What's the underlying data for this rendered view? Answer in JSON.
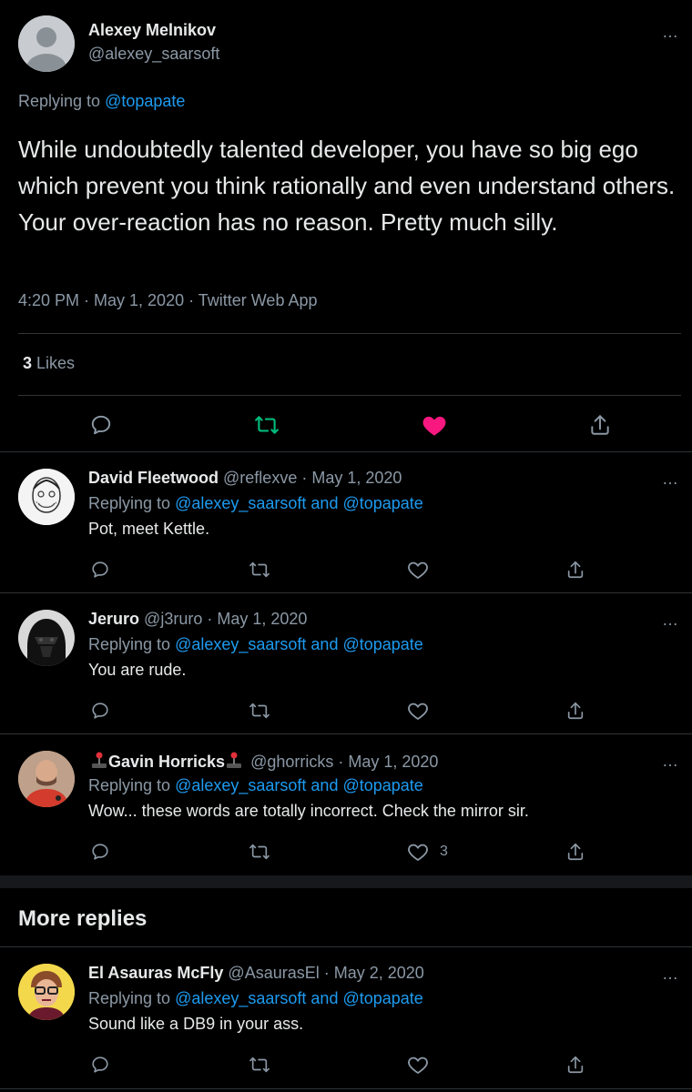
{
  "main_tweet": {
    "author_name": "Alexey Melnikov",
    "handle": "@alexey_saarsoft",
    "replying_prefix": "Replying to",
    "replying_to": "@topapate",
    "text": "While undoubtedly talented developer, you have so big ego which prevent you think rationally and even understand others. Your over-reaction has no reason. Pretty much silly.",
    "meta": "4:20 PM · May 1, 2020 · Twitter Web App",
    "likes_count": "3",
    "likes_label": "Likes",
    "more_icon": "…"
  },
  "replies": [
    {
      "name": "David Fleetwood",
      "handle": "@reflexve · May 1, 2020",
      "replying_prefix": "Replying to",
      "replying_to": "@alexey_saarsoft and @topapate",
      "text": "Pot, meet Kettle.",
      "like_count": ""
    },
    {
      "name": "Jeruro",
      "handle": "@j3ruro · May 1, 2020",
      "replying_prefix": "Replying to",
      "replying_to": "@alexey_saarsoft and @topapate",
      "text": "You are rude.",
      "like_count": ""
    },
    {
      "name": "Gavin Horricks",
      "handle": "@ghorricks · May 1, 2020",
      "replying_prefix": "Replying to",
      "replying_to": "@alexey_saarsoft and @topapate",
      "text": "Wow... these words are totally incorrect. Check the mirror sir.",
      "like_count": "3"
    }
  ],
  "more_replies_title": "More replies",
  "more_reply": {
    "name": "El Asauras McFly",
    "handle": "@AsaurasEl · May 2, 2020",
    "replying_prefix": "Replying to",
    "replying_to": "@alexey_saarsoft and @topapate",
    "text": "Sound like a DB9 in your ass.",
    "like_count": ""
  },
  "colors": {
    "background": "#000000",
    "text": "#e7e9ea",
    "muted": "#8b98a5",
    "link": "#1d9bf0",
    "retweeted": "#00ba7c",
    "liked": "#f91880",
    "divider": "#2f3336"
  },
  "icons": [
    "reply-icon",
    "retweet-icon",
    "like-icon",
    "share-icon",
    "more-icon",
    "joystick-emoji"
  ]
}
